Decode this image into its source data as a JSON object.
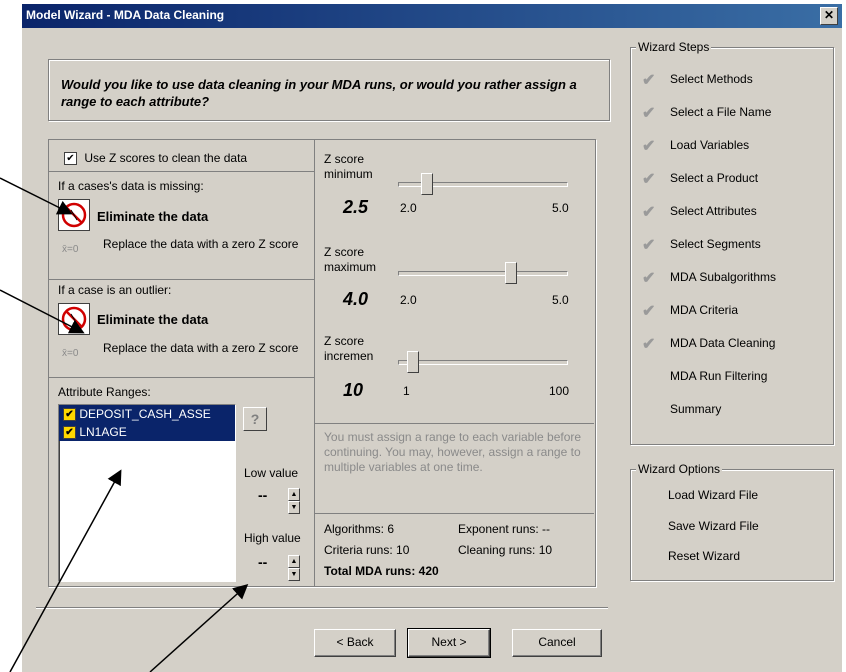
{
  "window": {
    "title": "Model Wizard - MDA Data Cleaning",
    "close_label": "✕"
  },
  "question": "Would you like to use data cleaning in your MDA runs, or would you rather assign a range to each attribute?",
  "cleaning": {
    "use_z_label": "Use Z scores to clean the data",
    "use_z_checked": true,
    "missing_heading": "If a cases's data is missing:",
    "missing_eliminate": "Eliminate the data",
    "missing_replace": "Replace the data with a zero Z score",
    "outlier_heading": "If a case is an outlier:",
    "outlier_eliminate": "Eliminate the data",
    "outlier_replace": "Replace the data with a zero Z score",
    "replace_icon_text": "x̄=0"
  },
  "zscore": {
    "min_label": "Z score minimum",
    "min_value": "2.5",
    "min_lo": "2.0",
    "min_hi": "5.0",
    "min_pos": 0.17,
    "max_label": "Z score maximum",
    "max_value": "4.0",
    "max_lo": "2.0",
    "max_hi": "5.0",
    "max_pos": 0.67,
    "inc_label": "Z score incremen",
    "inc_value": "10",
    "inc_lo": "1",
    "inc_hi": "100",
    "inc_pos": 0.09
  },
  "ranges": {
    "heading": "Attribute Ranges:",
    "items": [
      "DEPOSIT_CASH_ASSE",
      "LN1AGE"
    ],
    "help": "?",
    "low_label": "Low value",
    "low_value": "--",
    "high_label": "High value",
    "high_value": "--"
  },
  "note": "You must assign a range to each variable before continuing.  You may, however, assign a range to multiple variables at one time.",
  "runs": {
    "algorithms": "Algorithms: 6",
    "exponent": "Exponent runs: --",
    "criteria": "Criteria runs: 10",
    "cleaning": "Cleaning runs: 10",
    "total": "Total MDA runs: 420"
  },
  "buttons": {
    "back": "< Back",
    "next": "Next >",
    "cancel": "Cancel"
  },
  "steps": {
    "title": "Wizard Steps",
    "items": [
      {
        "label": "Select Methods",
        "done": true
      },
      {
        "label": "Select a File Name",
        "done": true
      },
      {
        "label": "Load Variables",
        "done": true
      },
      {
        "label": "Select a Product",
        "done": true
      },
      {
        "label": "Select Attributes",
        "done": true
      },
      {
        "label": "Select Segments",
        "done": true
      },
      {
        "label": "MDA Subalgorithms",
        "done": true
      },
      {
        "label": "MDA Criteria",
        "done": true
      },
      {
        "label": "MDA Data Cleaning",
        "done": true
      },
      {
        "label": "MDA Run Filtering",
        "done": false
      },
      {
        "label": "Summary",
        "done": false
      }
    ]
  },
  "options": {
    "title": "Wizard Options",
    "load": "Load Wizard File",
    "save": "Save Wizard File",
    "reset": "Reset Wizard"
  }
}
